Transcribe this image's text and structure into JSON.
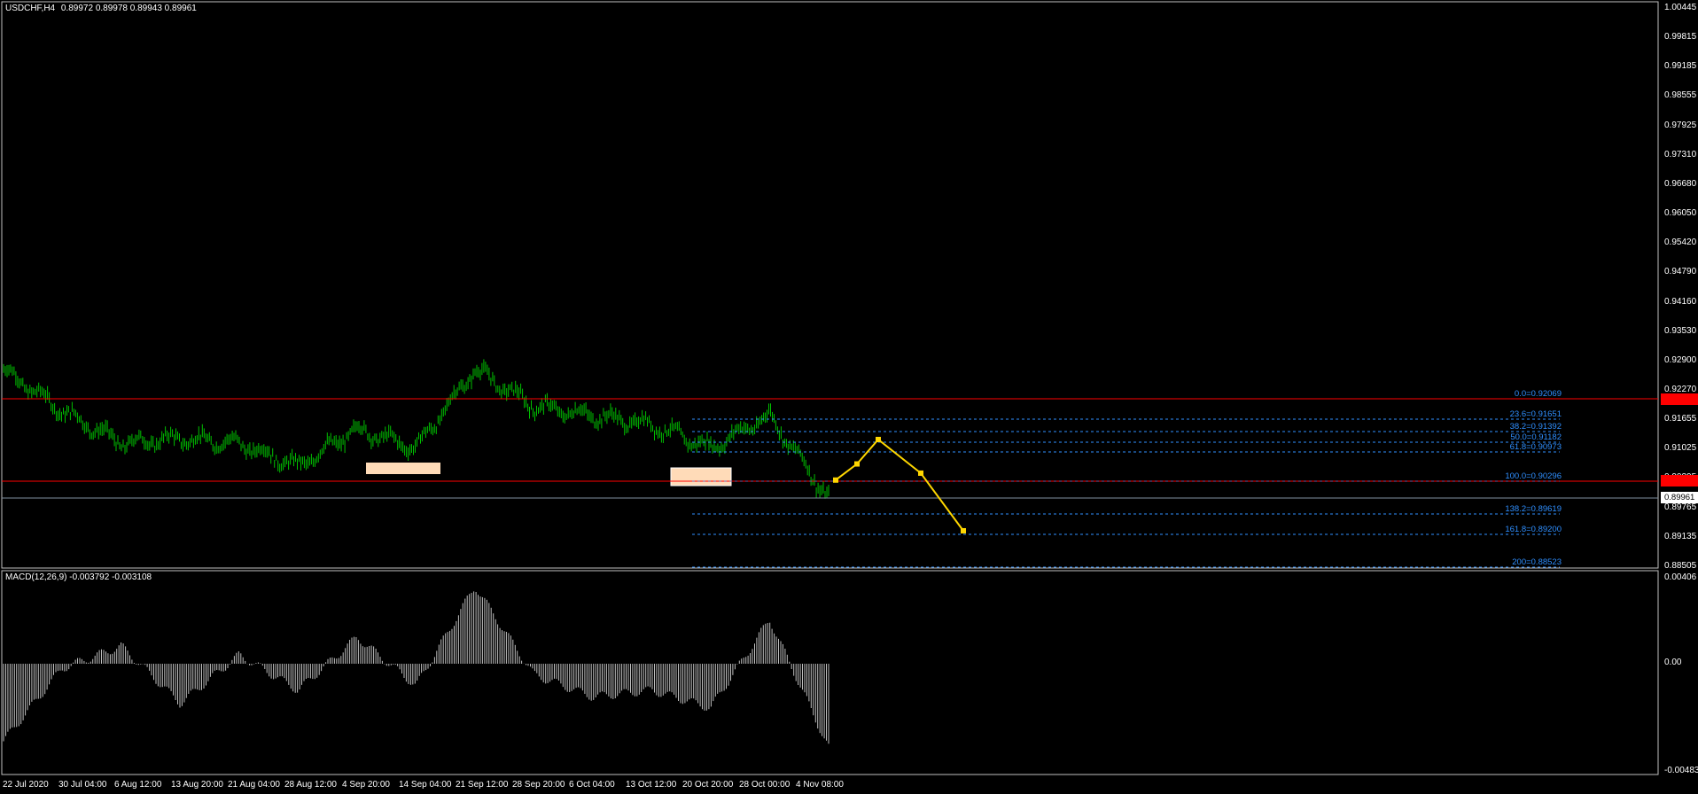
{
  "header": {
    "symbol": "USDCHF,H4",
    "ohlc": "0.89972 0.89978 0.89943 0.89961"
  },
  "macd": {
    "label": "MACD(12,26,9) -0.003792 -0.003108",
    "axis": [
      "0.00406",
      "0.00",
      "-0.004835"
    ]
  },
  "price_axis": [
    "1.00445",
    "0.99815",
    "0.99185",
    "0.98555",
    "0.97925",
    "0.97310",
    "0.96680",
    "0.96050",
    "0.95420",
    "0.94790",
    "0.94160",
    "0.93530",
    "0.92900",
    "0.92270",
    "0.91655",
    "0.91025",
    "0.90395",
    "0.89765",
    "0.89135",
    "0.88505"
  ],
  "price_labels": {
    "current": "0.89961",
    "upper_red": "0.92070",
    "lower_red": "0.90394"
  },
  "fib_levels": [
    "0.0=0.92069",
    "23.6=0.91651",
    "38.2=0.91392",
    "50.0=0.91182",
    "61.8=0.90973",
    "100.0=0.90296",
    "138.2=0.89619",
    "161.8=0.89200",
    "200=0.88523"
  ],
  "time_axis": [
    "22 Jul 2020",
    "30 Jul 04:00",
    "6 Aug 12:00",
    "13 Aug 20:00",
    "21 Aug 04:00",
    "28 Aug 12:00",
    "4 Sep 20:00",
    "14 Sep 04:00",
    "21 Sep 12:00",
    "28 Sep 20:00",
    "6 Oct 04:00",
    "13 Oct 12:00",
    "20 Oct 20:00",
    "28 Oct 00:00",
    "4 Nov 08:00"
  ],
  "colors": {
    "background": "#000000",
    "bars": "#00c000",
    "red_line": "#ff0000",
    "fib": "#2f8fff",
    "projection": "#ffd700",
    "zone": "#ffdbb8",
    "macd": "#c0c0c0"
  },
  "chart_data": {
    "type": "line",
    "title": "USDCHF,H4",
    "ylim": [
      0.8845,
      1.0052
    ],
    "x": [
      "22 Jul 2020",
      "30 Jul 04:00",
      "6 Aug 12:00",
      "13 Aug 20:00",
      "21 Aug 04:00",
      "28 Aug 12:00",
      "4 Sep 20:00",
      "14 Sep 04:00",
      "21 Sep 12:00",
      "28 Sep 20:00",
      "6 Oct 04:00",
      "13 Oct 12:00",
      "20 Oct 20:00",
      "28 Oct 00:00",
      "4 Nov 08:00"
    ],
    "series": [
      {
        "values": [
          0.927,
          0.918,
          0.911,
          0.912,
          0.911,
          0.906,
          0.914,
          0.91,
          0.927,
          0.919,
          0.917,
          0.915,
          0.91,
          0.917,
          0.899
        ]
      }
    ],
    "projection": [
      0.903,
      0.9065,
      0.9118,
      0.9045,
      0.892
    ],
    "macd_values": [
      -0.0035,
      -0.0002,
      0.0008,
      -0.0018,
      0.0004,
      -0.0012,
      0.0012,
      -0.001,
      0.0035,
      -0.0005,
      -0.0015,
      -0.0012,
      -0.002,
      0.002,
      -0.0038
    ]
  }
}
